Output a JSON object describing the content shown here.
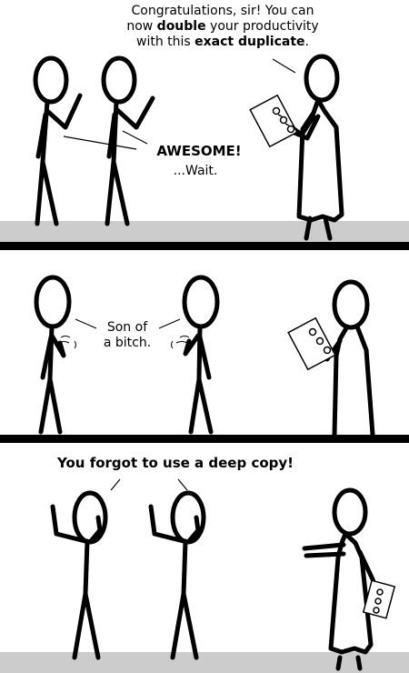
{
  "panel1": {
    "caption_line1": "Congratulations, sir! You can",
    "caption_line2_pre": "now ",
    "caption_line2_bold": "double",
    "caption_line2_post": " your productivity",
    "caption_line3_pre": "with this ",
    "caption_line3_bold": "exact duplicate",
    "caption_line3_post": ".",
    "awesome": "AWESOME!",
    "wait": "...Wait."
  },
  "panel2": {
    "line1": "Son of",
    "line2": "a bitch."
  },
  "panel3": {
    "caption": "You forgot to use a deep copy!"
  },
  "colors": {
    "floor": "#cccccc",
    "divider": "#000000",
    "ink": "#000000"
  }
}
